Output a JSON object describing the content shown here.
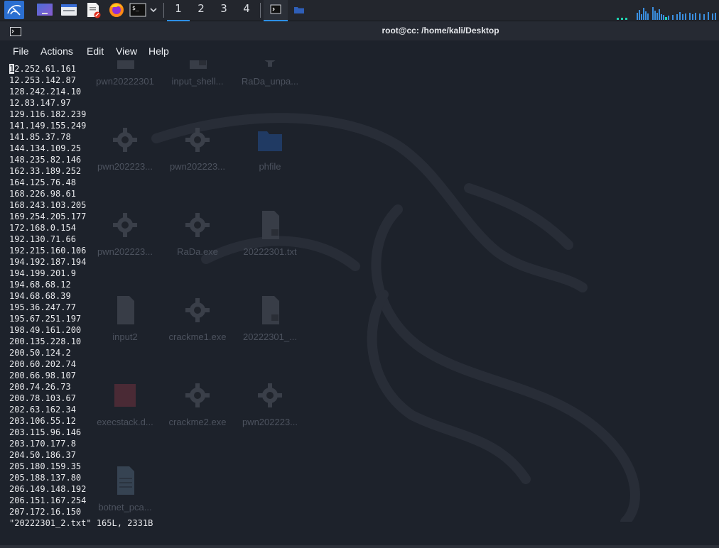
{
  "taskbar": {
    "workspaces": [
      {
        "label": "1",
        "active": true
      },
      {
        "label": "2",
        "active": false
      },
      {
        "label": "3",
        "active": false
      },
      {
        "label": "4",
        "active": false
      }
    ]
  },
  "window": {
    "title": "root@cc: /home/kali/Desktop"
  },
  "menu": {
    "file": "File",
    "actions": "Actions",
    "edit": "Edit",
    "view": "View",
    "help": "Help"
  },
  "desktop": {
    "icons": [
      {
        "label": "pwn20222301",
        "icon": "file-icon"
      },
      {
        "label": "input_shell...",
        "icon": "locked-file-icon"
      },
      {
        "label": "RaDa_unpa...",
        "icon": "gear-icon"
      },
      {
        "label": "pwn202223...",
        "icon": "gear-icon"
      },
      {
        "label": "pwn202223...",
        "icon": "gear-icon"
      },
      {
        "label": "phfile",
        "icon": "folder-icon"
      },
      {
        "label": "pwn202223...",
        "icon": "gear-icon"
      },
      {
        "label": "RaDa.exe",
        "icon": "gear-icon"
      },
      {
        "label": "20222301.txt",
        "icon": "locked-file-icon"
      },
      {
        "label": "input2",
        "icon": "file-icon"
      },
      {
        "label": "crackme1.exe",
        "icon": "gear-icon"
      },
      {
        "label": "20222301_...",
        "icon": "locked-file-icon"
      },
      {
        "label": "execstack.d...",
        "icon": "package-icon"
      },
      {
        "label": "crackme2.exe",
        "icon": "gear-icon"
      },
      {
        "label": "pwn202223...",
        "icon": "gear-icon"
      },
      {
        "label": "botnet_pca...",
        "icon": "spreadsheet-icon"
      }
    ]
  },
  "terminal": {
    "cursor_char": "1",
    "first_line_rest": "2.252.61.161",
    "lines": [
      "12.253.142.87",
      "128.242.214.10",
      "12.83.147.97",
      "129.116.182.239",
      "141.149.155.249",
      "141.85.37.78",
      "144.134.109.25",
      "148.235.82.146",
      "162.33.189.252",
      "164.125.76.48",
      "168.226.98.61",
      "168.243.103.205",
      "169.254.205.177",
      "172.168.0.154",
      "192.130.71.66",
      "192.215.160.106",
      "194.192.187.194",
      "194.199.201.9",
      "194.68.68.12",
      "194.68.68.39",
      "195.36.247.77",
      "195.67.251.197",
      "198.49.161.200",
      "200.135.228.10",
      "200.50.124.2",
      "200.60.202.74",
      "200.66.98.107",
      "200.74.26.73",
      "200.78.103.67",
      "202.63.162.34",
      "203.106.55.12",
      "203.115.96.146",
      "203.170.177.8",
      "204.50.186.37",
      "205.180.159.35",
      "205.188.137.80",
      "206.149.148.192",
      "206.151.167.254",
      "207.172.16.150"
    ],
    "status": "\"20222301_2.txt\" 165L, 2331B"
  }
}
